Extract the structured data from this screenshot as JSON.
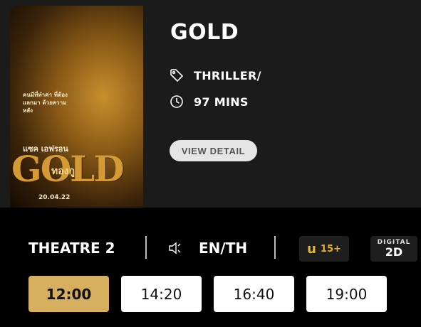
{
  "movie": {
    "title": "GOLD",
    "genre": "THRILLER/",
    "duration": "97 MINS",
    "view_detail_label": "VIEW DETAIL",
    "poster": {
      "tagline": "คนมีที่ทำค่า ที่ต้องแลกมา ด้วยความหลัง",
      "actor": "แซค เอฟรอน",
      "logo_en": "GOLD",
      "logo_th": "ทองกู",
      "date": "20.04.22"
    }
  },
  "session": {
    "theatre": "THEATRE 2",
    "language": "EN/TH",
    "rating_letter": "u",
    "rating_age": "15+",
    "format_top": "DIGITAL",
    "format_main": "2D"
  },
  "showtimes": [
    {
      "time": "12:00",
      "selected": true
    },
    {
      "time": "14:20",
      "selected": false
    },
    {
      "time": "16:40",
      "selected": false
    },
    {
      "time": "19:00",
      "selected": false
    }
  ],
  "colors": {
    "accent_gold": "#d5ae5e",
    "rating_yellow": "#e7b52a",
    "card_bg": "#1b1b1b"
  },
  "icons": {
    "genre": "tag-icon",
    "duration": "clock-icon",
    "audio": "speaker-icon"
  }
}
